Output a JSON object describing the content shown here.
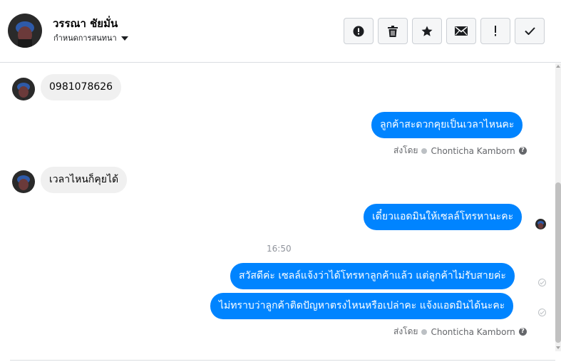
{
  "header": {
    "contact_name": "วรรณา ชัยมั่น",
    "conversation_settings": "กำหนดการสนทนา",
    "toolbar": [
      {
        "icon": "alert-circle-icon",
        "name": "mark-spam-button"
      },
      {
        "icon": "trash-icon",
        "name": "delete-button"
      },
      {
        "icon": "star-icon",
        "name": "star-button"
      },
      {
        "icon": "envelope-icon",
        "name": "mark-unread-button"
      },
      {
        "icon": "exclamation-icon",
        "name": "follow-up-button"
      },
      {
        "icon": "checkmark-icon",
        "name": "mark-done-button"
      }
    ]
  },
  "thread": {
    "messages": [
      {
        "direction": "incoming",
        "text": "0981078626"
      },
      {
        "direction": "outgoing",
        "text": "ลูกค้าสะดวกคุยเป็นเวลาไหนคะ"
      },
      {
        "direction": "incoming",
        "text": "เวลาไหนก็คุยได้"
      },
      {
        "direction": "outgoing",
        "text": "เดี๋ยวแอดมินให้เซลล์โทรหานะคะ"
      },
      {
        "direction": "outgoing",
        "text": "สวัสดีค่ะ เซลล์แจ้งว่าได้โทรหาลูกค้าแล้ว แต่ลูกค้าไม่รับสายค่ะ"
      },
      {
        "direction": "outgoing",
        "text": "ไม่ทราบว่าลูกค้าติดปัญหาตรงไหนหรือเปล่าคะ แจ้งแอดมินได้นะคะ"
      }
    ],
    "sent_by_label": "ส่งโดย",
    "sender_name": "Chonticha Kamborn",
    "help_symbol": "?",
    "timestamp": "16:50"
  },
  "colors": {
    "outgoing_bubble": "#0084ff",
    "incoming_bubble": "#f0f0f0",
    "secondary_text": "#65676b"
  }
}
